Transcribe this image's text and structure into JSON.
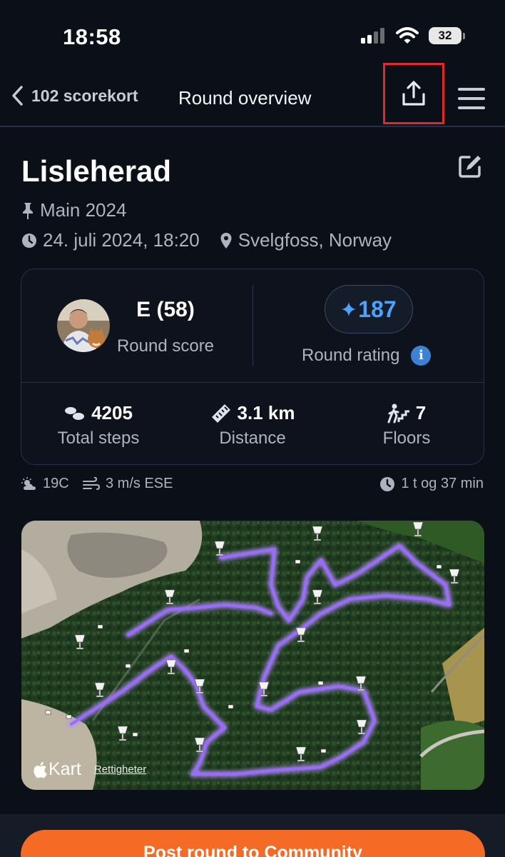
{
  "status_bar": {
    "time": "18:58",
    "battery": "32"
  },
  "nav": {
    "back_label": "102 scorekort",
    "title": "Round overview"
  },
  "course": {
    "name": "Lisleherad",
    "layout": "Main 2024",
    "datetime": "24. juli 2024, 18:20",
    "location": "Svelgfoss, Norway"
  },
  "score": {
    "value": "E (58)",
    "label": "Round score",
    "rating_value": "187",
    "rating_label": "Round rating"
  },
  "stats": {
    "steps_value": "4205",
    "steps_label": "Total steps",
    "distance_value": "3.1 km",
    "distance_label": "Distance",
    "floors_value": "7",
    "floors_label": "Floors"
  },
  "conditions": {
    "temperature": "19C",
    "wind": "3 m/s ESE",
    "duration": "1 t og 37 min"
  },
  "map": {
    "brand": "Kart",
    "rights": "Rettigheter"
  },
  "actions": {
    "post_label": "Post round to Community"
  },
  "colors": {
    "accent_blue": "#4ea2ff",
    "cta_orange": "#f56a24",
    "highlight_red": "#e0282e",
    "route_purple": "#9b6bff"
  },
  "icons": [
    "chevron-left-icon",
    "share-icon",
    "menu-icon",
    "edit-icon",
    "pin-icon",
    "clock-icon",
    "location-icon",
    "sparkle-icon",
    "info-icon",
    "footsteps-icon",
    "ruler-icon",
    "stairs-icon",
    "weather-icon",
    "wind-icon",
    "basket-icon",
    "apple-icon"
  ]
}
